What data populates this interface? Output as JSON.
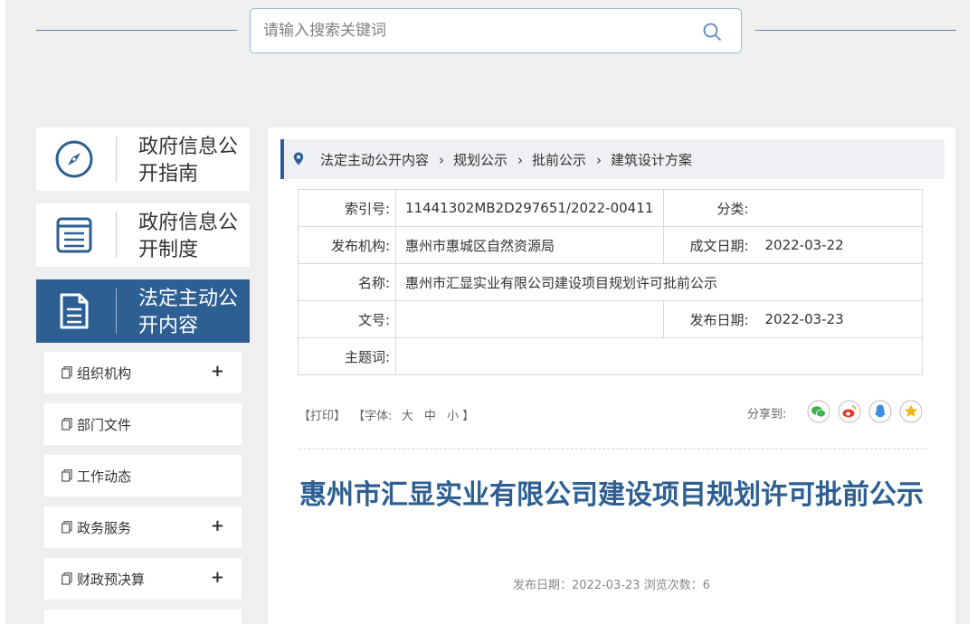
{
  "search": {
    "placeholder": "请输入搜索关键词",
    "icon": "search-icon"
  },
  "nav_cards": [
    {
      "label": "政府信息公开指南",
      "icon": "compass-icon"
    },
    {
      "label": "政府信息公开制度",
      "icon": "list-document-icon"
    },
    {
      "label": "法定主动公开内容",
      "icon": "document-icon",
      "active": true
    }
  ],
  "side_items": [
    {
      "label": "组织机构",
      "expand": "+"
    },
    {
      "label": "部门文件",
      "expand": ""
    },
    {
      "label": "工作动态",
      "expand": ""
    },
    {
      "label": "政务服务",
      "expand": "+"
    },
    {
      "label": "财政预决算",
      "expand": "+"
    }
  ],
  "breadcrumb": [
    "法定主动公开内容",
    "规划公示",
    "批前公示",
    "建筑设计方案"
  ],
  "meta": {
    "index_label": "索引号:",
    "index_value": "11441302MB2D297651/2022-00411",
    "category_label": "分类:",
    "category_value": "",
    "publisher_label": "发布机构:",
    "publisher_value": "惠州市惠城区自然资源局",
    "created_label": "成文日期:",
    "created_value": "2022-03-22",
    "name_label": "名称:",
    "name_value": "惠州市汇显实业有限公司建设项目规划许可批前公示",
    "docno_label": "文号:",
    "docno_value": "",
    "pubdate_label": "发布日期:",
    "pubdate_value": "2022-03-23",
    "subject_label": "主题词:",
    "subject_value": ""
  },
  "tools": {
    "print": "【打印】",
    "font_prefix": "【字体:",
    "font_large": "大",
    "font_medium": "中",
    "font_small": "小",
    "font_suffix": "】"
  },
  "share": {
    "label": "分享到:",
    "icons": [
      "wechat-icon",
      "weibo-icon",
      "qq-icon",
      "qzone-icon"
    ]
  },
  "article": {
    "title": "惠州市汇显实业有限公司建设项目规划许可批前公示",
    "info": "发布日期：2022-03-23  浏览次数：6"
  },
  "colors": {
    "accent": "#2d5f92",
    "background": "#efefef"
  }
}
